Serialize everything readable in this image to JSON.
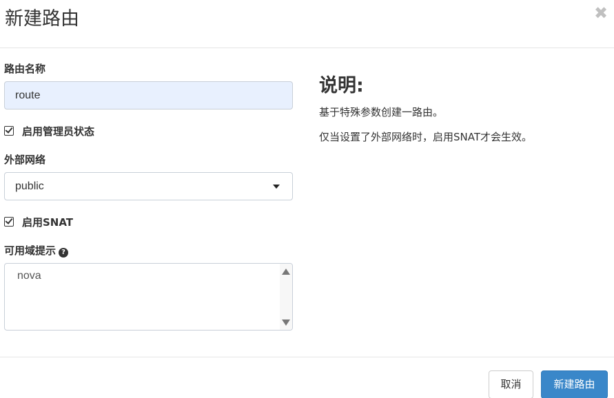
{
  "dialog": {
    "title": "新建路由",
    "close_glyph": "✖"
  },
  "form": {
    "name": {
      "label": "路由名称",
      "value": "route"
    },
    "admin_state": {
      "label": "启用管理员状态",
      "checked": true
    },
    "external_network": {
      "label": "外部网络",
      "selected": "public"
    },
    "snat": {
      "label": "启用SNAT",
      "checked": true
    },
    "availability_zone_hints": {
      "label": "可用域提示",
      "help_icon": "question-circle-icon",
      "options": [
        "nova"
      ]
    }
  },
  "description": {
    "title": "说明:",
    "line1": "基于特殊参数创建一路由。",
    "line2": "仅当设置了外部网络时，启用SNAT才会生效。"
  },
  "footer": {
    "cancel_label": "取消",
    "submit_label": "新建路由"
  },
  "colors": {
    "primary": "#3a87c9",
    "input_autofill_bg": "#e8f0fe"
  }
}
